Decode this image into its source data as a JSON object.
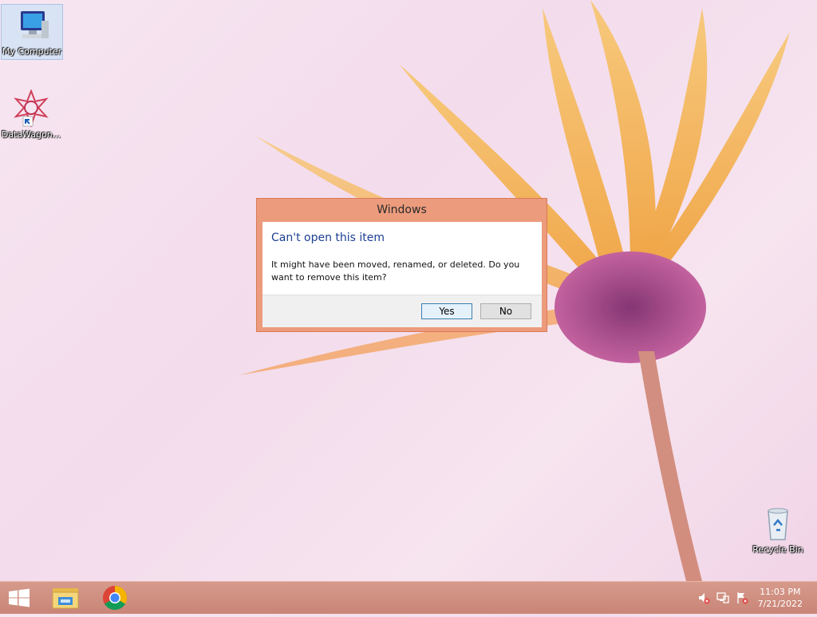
{
  "desktop": {
    "icons": [
      {
        "label": "My Computer"
      },
      {
        "label": "DataWagon..."
      },
      {
        "label": "Recycle Bin"
      }
    ]
  },
  "dialog": {
    "title": "Windows",
    "heading": "Can't open this item",
    "message": "It might have been moved, renamed, or deleted. Do you want to remove this item?",
    "yes_label": "Yes",
    "no_label": "No"
  },
  "taskbar": {
    "pinned": [
      "windows-logo-icon",
      "file-explorer-icon",
      "chrome-icon"
    ],
    "tray": [
      "volume-muted-icon",
      "network-icon",
      "action-center-icon"
    ],
    "time": "11:03 PM",
    "date": "7/21/2022"
  },
  "colors": {
    "dialog_frame": "#ec9b7c",
    "dialog_heading": "#1c3f94",
    "taskbar": "#cf8f81"
  }
}
